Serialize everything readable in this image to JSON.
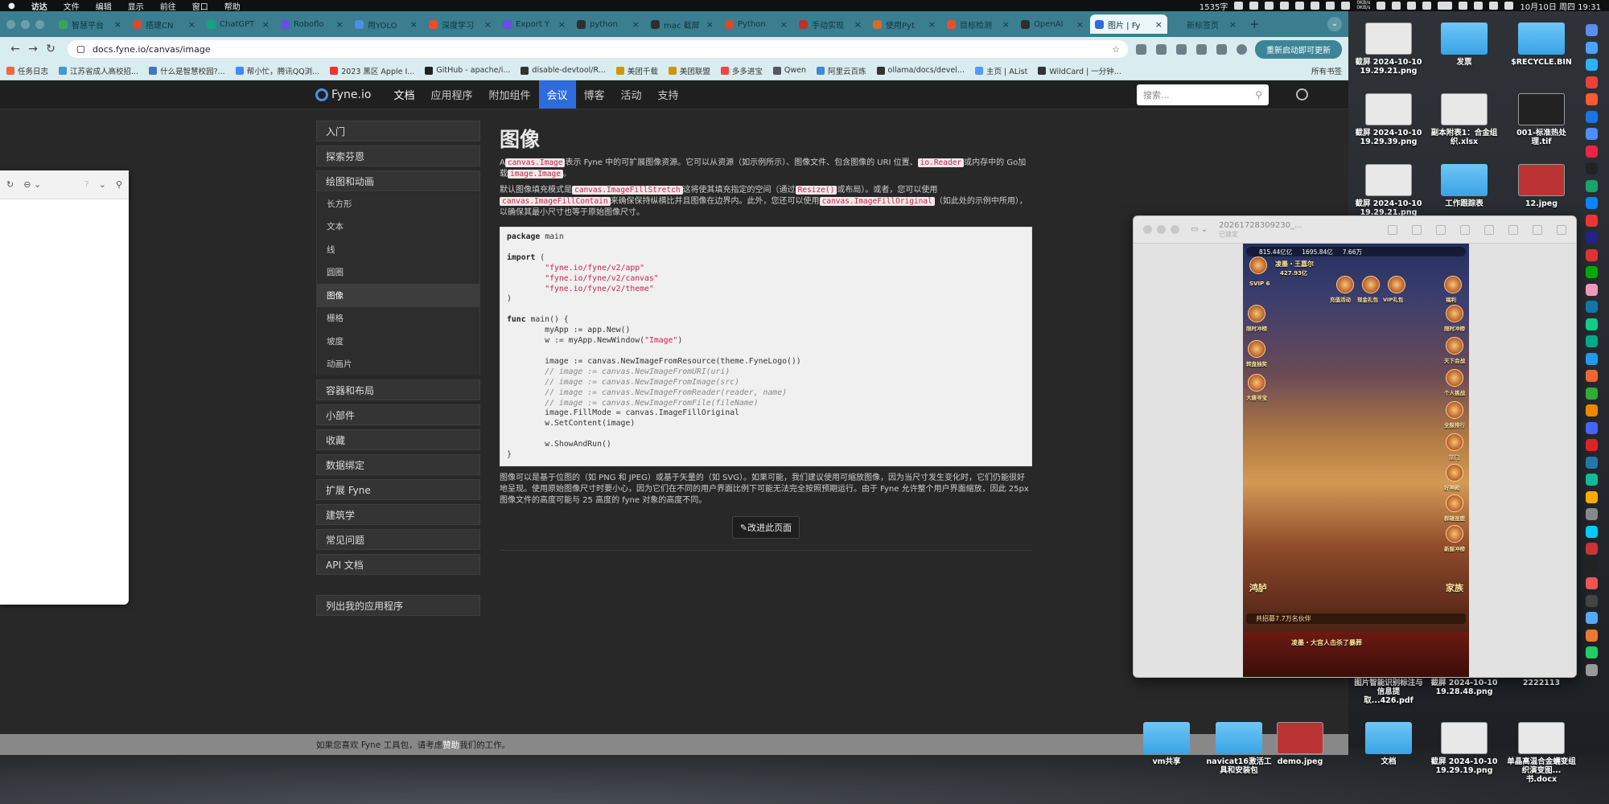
{
  "menubar": {
    "app": "访达",
    "items": [
      "文件",
      "编辑",
      "显示",
      "前往",
      "窗口",
      "帮助"
    ],
    "tray_text": "1535字",
    "net_up": "0KB/s",
    "net_down": "0KB/s",
    "clock": "10月10日 周四 19:31"
  },
  "browser": {
    "tabs": [
      {
        "label": "智慧平台",
        "color": "#3aa35a"
      },
      {
        "label": "搭建CN",
        "color": "#d9482b"
      },
      {
        "label": "ChatGPT",
        "color": "#10a37f"
      },
      {
        "label": "Roboflo",
        "color": "#6b4ce6"
      },
      {
        "label": "用YOLO",
        "color": "#4a90e2"
      },
      {
        "label": "深度学习",
        "color": "#e8502a"
      },
      {
        "label": "Export Y",
        "color": "#6b4ce6"
      },
      {
        "label": "python",
        "color": "#2f2f2f"
      },
      {
        "label": "mac 截屏",
        "color": "#2f2f2f"
      },
      {
        "label": "Python",
        "color": "#d9482b"
      },
      {
        "label": "手动实现",
        "color": "#c2302a"
      },
      {
        "label": "使用Pyt",
        "color": "#d86b2a"
      },
      {
        "label": "目标检测",
        "color": "#e8502a"
      },
      {
        "label": "OpenAI",
        "color": "#2f2f2f"
      },
      {
        "label": "图片 | Fy",
        "color": "#2e6bdd"
      },
      {
        "label": "新标签页",
        "color": "#3a7e90"
      }
    ],
    "active_tab_index": 14,
    "url": "docs.fyne.io/canvas/image",
    "update_button": "重新启动即可更新",
    "bookmarks": [
      "任务日志",
      "江苏省成人高校招...",
      "什么是智慧校园?...",
      "帮小忙，腾讯QQ浏...",
      "2023 黑区 Apple I...",
      "GitHub - apache/i...",
      "disable-devtool/R...",
      "美团千载",
      "美团联盟",
      "多多进宝",
      "Qwen",
      "阿里云百炼",
      "ollama/docs/devel...",
      "主页 | AList",
      "WildCard | 一分钟..."
    ],
    "bookmarks_all": "所有书签"
  },
  "site": {
    "logo": "Fyne.io",
    "nav": [
      "文档",
      "应用程序",
      "附加组件",
      "会议",
      "博客",
      "活动",
      "支持"
    ],
    "nav_current_index": 0,
    "nav_highlight_index": 3,
    "search_placeholder": "搜索...",
    "sidebar": [
      {
        "label": "入门"
      },
      {
        "label": "探索芬恩"
      },
      {
        "label": "绘图和动画",
        "children": [
          "长方形",
          "文本",
          "线",
          "圆圈",
          "图像",
          "栅格",
          "坡度",
          "动画片"
        ],
        "selected": "图像"
      },
      {
        "label": "容器和布局"
      },
      {
        "label": "小部件"
      },
      {
        "label": "收藏"
      },
      {
        "label": "数据绑定"
      },
      {
        "label": "扩展 Fyne"
      },
      {
        "label": "建筑学"
      },
      {
        "label": "常见问题"
      },
      {
        "label": "API 文档"
      }
    ],
    "sidebar_extra": "列出我的应用程序",
    "content": {
      "title": "图像",
      "p1": {
        "a": "A",
        "code1": "canvas.Image",
        "b": "表示 Fyne 中的可扩展图像资源。它可以从资源（如示例所示）、图像文件、包含图像的 URI 位置、",
        "code2": "io.Reader",
        "c": "或内存中的 Go加载",
        "code3": "image.Image",
        "d": "。"
      },
      "p2": {
        "a": "默认图像填充模式是",
        "code1": "canvas.ImageFillStretch",
        "b": "这将使其填充指定的空间（通过",
        "code2": "Resize()",
        "c": "或布局）。或者，您可以使用",
        "code3": "canvas.ImageFillContain",
        "d": "来确保保持纵横比并且图像在边界内。此外，您还可以使用",
        "code4": "canvas.ImageFillOriginal",
        "e": "（如此处的示例中所用），以确保其最小尺寸也等于原始图像尺寸。"
      },
      "code_lines": [
        [
          "kw",
          "package"
        ],
        [
          "",
          " main"
        ],
        [
          "nl"
        ],
        [
          "nl"
        ],
        [
          "kw",
          "import"
        ],
        [
          "",
          " ("
        ],
        [
          "nl"
        ],
        [
          "",
          "        "
        ],
        [
          "str",
          "\"fyne.io/fyne/v2/app\""
        ],
        [
          "nl"
        ],
        [
          "",
          "        "
        ],
        [
          "str",
          "\"fyne.io/fyne/v2/canvas\""
        ],
        [
          "nl"
        ],
        [
          "",
          "        "
        ],
        [
          "str",
          "\"fyne.io/fyne/v2/theme\""
        ],
        [
          "nl"
        ],
        [
          "",
          ")"
        ],
        [
          "nl"
        ],
        [
          "nl"
        ],
        [
          "kw",
          "func"
        ],
        [
          "",
          " main() {"
        ],
        [
          "nl"
        ],
        [
          "",
          "        myApp := app.New()"
        ],
        [
          "nl"
        ],
        [
          "",
          "        w := myApp.NewWindow("
        ],
        [
          "str",
          "\"Image\""
        ],
        [
          "",
          ")"
        ],
        [
          "nl"
        ],
        [
          "nl"
        ],
        [
          "",
          "        image := canvas.NewImageFromResource(theme.FyneLogo())"
        ],
        [
          "nl"
        ],
        [
          "",
          "        "
        ],
        [
          "cm",
          "// image := canvas.NewImageFromURI(uri)"
        ],
        [
          "nl"
        ],
        [
          "",
          "        "
        ],
        [
          "cm",
          "// image := canvas.NewImageFromImage(src)"
        ],
        [
          "nl"
        ],
        [
          "",
          "        "
        ],
        [
          "cm",
          "// image := canvas.NewImageFromReader(reader, name)"
        ],
        [
          "nl"
        ],
        [
          "",
          "        "
        ],
        [
          "cm",
          "// image := canvas.NewImageFromFile(fileName)"
        ],
        [
          "nl"
        ],
        [
          "",
          "        image.FillMode = canvas.ImageFillOriginal"
        ],
        [
          "nl"
        ],
        [
          "",
          "        w.SetContent(image)"
        ],
        [
          "nl"
        ],
        [
          "nl"
        ],
        [
          "",
          "        w.ShowAndRun()"
        ],
        [
          "nl"
        ],
        [
          "",
          "}"
        ]
      ],
      "p3": "图像可以是基于位图的（如 PNG 和 JPEG）或基于矢量的（如 SVG）。如果可能，我们建议使用可缩放图像，因为当尺寸发生变化时，它们仍能很好地呈现。使用原始图像尺寸时要小心，因为它们在不同的用户界面比例下可能无法完全按照预期运行。由于 Fyne 允许整个用户界面缩放，因此 25px 图像文件的高度可能与 25 高度的 fyne 对象的高度不同。",
      "improve": "改进此页面"
    },
    "footer": {
      "a": "如果您喜欢 Fyne 工具包，请考虑",
      "link": "赞助",
      "b": "我们的工作。"
    }
  },
  "preview": {
    "title": "20261728309230_...",
    "subtitle": "已锁定",
    "game": {
      "stat1": "815.44亿亿",
      "stat2": "1695.84亿",
      "stat3": "7.66万",
      "player": "凌墨・王嘉尔",
      "power": "427.93亿",
      "vip": "SVIP 6",
      "buttons": [
        "充值活动",
        "现金礼包",
        "VIP礼包",
        "福利"
      ],
      "left_labels": [
        "限时冲榜",
        "转盘抽奖",
        "大唐寻宝"
      ],
      "right_labels": [
        "限时冲榜",
        "天下会战",
        "个人挑战",
        "全服排行",
        "宗门",
        "好神殿",
        "群雄逐鹿",
        "新服冲榜"
      ],
      "bottom_left": "鸿胪",
      "bottom_right": "家族",
      "news": "共招募7.7万名伙伴",
      "news2": "凌墨・大宫人击杀了暴葬"
    }
  },
  "desktop": {
    "icons": [
      {
        "label": "截屏 2024-10-10 19.29.21.png",
        "kind": "shot"
      },
      {
        "label": "发票",
        "kind": "folder"
      },
      {
        "label": "$RECYCLE.BIN",
        "kind": "folder"
      },
      {
        "label": "截屏 2024-10-10 19.29.39.png",
        "kind": "shot"
      },
      {
        "label": "副本附表1：合金组织.xlsx",
        "kind": "xlsx"
      },
      {
        "label": "001-标准热处理.tif",
        "kind": "tif"
      },
      {
        "label": "截屏 2024-10-10 19.29.21.png",
        "kind": "shot"
      },
      {
        "label": "工作跟踪表",
        "kind": "folder"
      },
      {
        "label": "12.jpeg",
        "kind": "jpeg"
      },
      {
        "label": "图片智能识别标注与信息提取...426.pdf",
        "kind": "pdf"
      },
      {
        "label": "截屏 2024-10-10 19.28.48.png",
        "kind": "shot"
      },
      {
        "label": "2222113",
        "kind": "file"
      },
      {
        "label": "vm共享",
        "kind": "folder"
      },
      {
        "label": "navicat16激活工具和安装包",
        "kind": "folder"
      },
      {
        "label": "demo.jpeg",
        "kind": "jpeg"
      },
      {
        "label": "文档",
        "kind": "folder"
      },
      {
        "label": "截屏 2024-10-10 19.29.19.png",
        "kind": "shot"
      },
      {
        "label": "单晶高温合金蠕变组织演变图...书.docx",
        "kind": "docx"
      }
    ]
  },
  "leftwin": {
    "tip": "?"
  },
  "colors": {
    "accent": "#2e6bdd",
    "tabbar": "#3a7e90",
    "code_string": "#c7254e"
  }
}
